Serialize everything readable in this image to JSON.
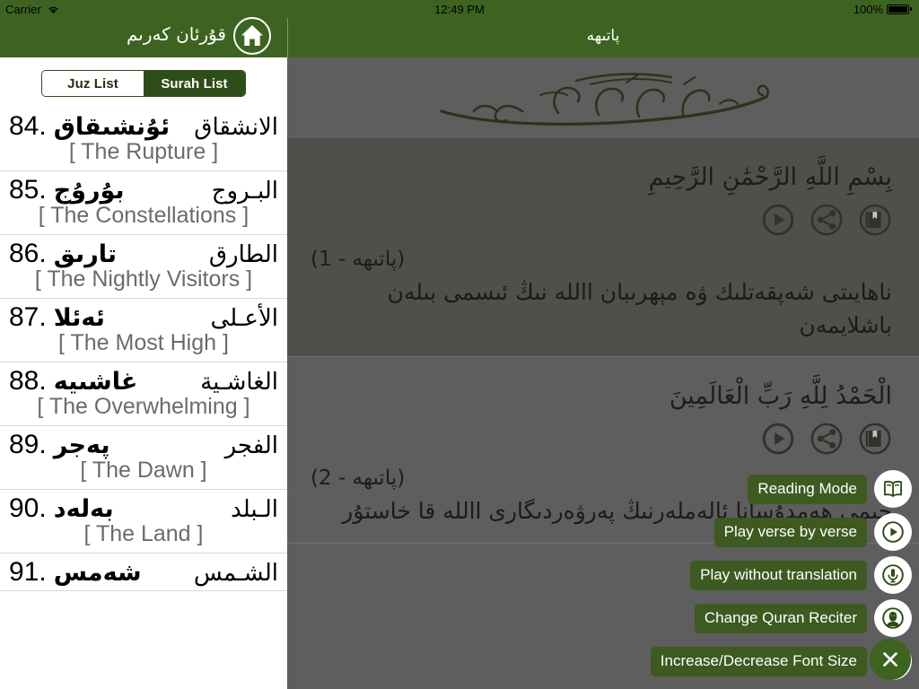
{
  "statusbar": {
    "carrier": "Carrier",
    "wifi_icon": "wifi-icon",
    "time": "12:49 PM",
    "battery_percent": "100%",
    "battery_icon": "battery-full-icon"
  },
  "navbar": {
    "left_title": "قۇرئان كەرىم",
    "home_icon": "home-icon",
    "right_title": "پاتىھە"
  },
  "sidebar": {
    "segment": {
      "juz_label": "Juz List",
      "surah_label": "Surah List",
      "selected": "Surah List"
    },
    "surahs": [
      {
        "number": "84.",
        "arabic": "الانشقاق",
        "uyghur": "ئۇنشىقاق",
        "english": "[ The Rupture ]"
      },
      {
        "number": "85.",
        "arabic": "البـروج",
        "uyghur": "بۇرۇج",
        "english": "[ The Constellations ]"
      },
      {
        "number": "86.",
        "arabic": "الطارق",
        "uyghur": "تارىق",
        "english": "[ The Nightly Visitors ]"
      },
      {
        "number": "87.",
        "arabic": "الأعـلى",
        "uyghur": "ئەئلا",
        "english": "[ The Most High ]"
      },
      {
        "number": "88.",
        "arabic": "الغاشـية",
        "uyghur": "غاشىيه",
        "english": "[ The Overwhelming ]"
      },
      {
        "number": "89.",
        "arabic": "الفجر",
        "uyghur": "پەجر",
        "english": "[ The Dawn ]"
      },
      {
        "number": "90.",
        "arabic": "الـبلد",
        "uyghur": "بەلەد",
        "english": "[ The Land ]"
      },
      {
        "number": "91.",
        "arabic": "الشـمس",
        "uyghur": "شەمس",
        "english": ""
      }
    ]
  },
  "content": {
    "bismillah_calligraphy": "بسم الله الرحمن الرحيم",
    "verses": [
      {
        "arabic": "بِسْمِ اللَّهِ الرَّحْمَٰنِ الرَّحِيمِ",
        "label": "(پاتىھە - 1)",
        "translation": "ناھايىتى شەپقەتلىك ۋە مېھرىبان االله نىڭ ئىسمى بىلەن باشلايمەن",
        "play_icon": "play-circle-icon",
        "share_icon": "share-icon",
        "bookmark_icon": "bookmark-book-icon"
      },
      {
        "arabic": "الْحَمْدُ لِلَّهِ رَبِّ الْعَالَمِينَ",
        "label": "(پاتىھە - 2)",
        "translation": "جىمى ھەمدۇسانا ئالەملەرنىڭ پەرۋەردىگارى االله قا خاستۇر",
        "play_icon": "play-circle-icon",
        "share_icon": "share-icon",
        "bookmark_icon": "bookmark-book-icon"
      }
    ]
  },
  "action_menu": {
    "items": [
      {
        "label": "Reading Mode",
        "icon": "open-book-icon"
      },
      {
        "label": "Play verse by verse",
        "icon": "play-circle-icon"
      },
      {
        "label": "Play without translation",
        "icon": "microphone-icon"
      },
      {
        "label": "Change Quran Reciter",
        "icon": "reciter-person-icon"
      },
      {
        "label": "Increase/Decrease Font Size",
        "icon": "font-size-a-icon"
      }
    ],
    "close_icon": "close-x-icon"
  },
  "colors": {
    "brand_green": "#3d6320",
    "menu_green": "#3d5a21",
    "content_gray": "#6d6d6d",
    "verse_alt": "#565a52"
  }
}
